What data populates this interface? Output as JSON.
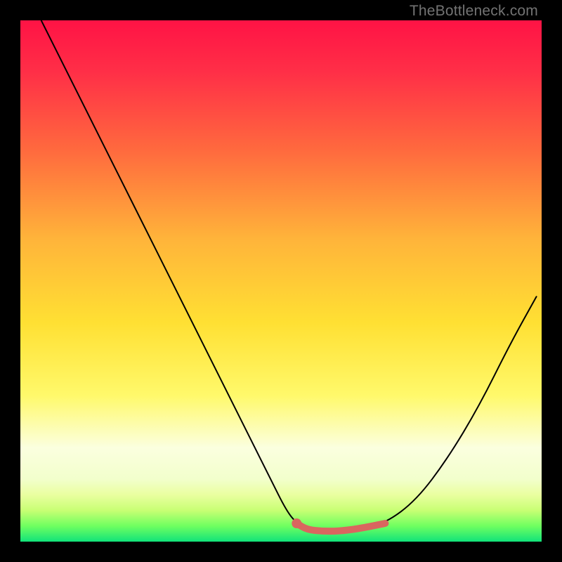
{
  "watermark": "TheBottleneck.com",
  "chart_data": {
    "type": "line",
    "title": "",
    "xlabel": "",
    "ylabel": "",
    "xlim": [
      0,
      100
    ],
    "ylim": [
      0,
      100
    ],
    "series": [
      {
        "name": "bottleneck-curve",
        "color": "#000000",
        "x": [
          4,
          8,
          12,
          16,
          20,
          24,
          28,
          32,
          36,
          40,
          44,
          48,
          51,
          53,
          55,
          58,
          61,
          65,
          70,
          76,
          82,
          88,
          94,
          99
        ],
        "values": [
          100,
          92,
          84,
          76,
          68,
          60,
          52,
          44,
          36,
          28,
          20,
          12,
          6,
          3.5,
          2.3,
          2,
          2,
          2.5,
          3.5,
          8,
          16,
          26,
          38,
          47
        ]
      },
      {
        "name": "highlight-segment",
        "color": "#d9665f",
        "x": [
          53,
          55,
          58,
          61,
          65,
          70
        ],
        "values": [
          3.5,
          2.3,
          2,
          2,
          2.5,
          3.5
        ]
      }
    ],
    "markers": [
      {
        "name": "highlight-dot",
        "x": 53,
        "y": 3.5,
        "color": "#d9665f"
      }
    ]
  }
}
